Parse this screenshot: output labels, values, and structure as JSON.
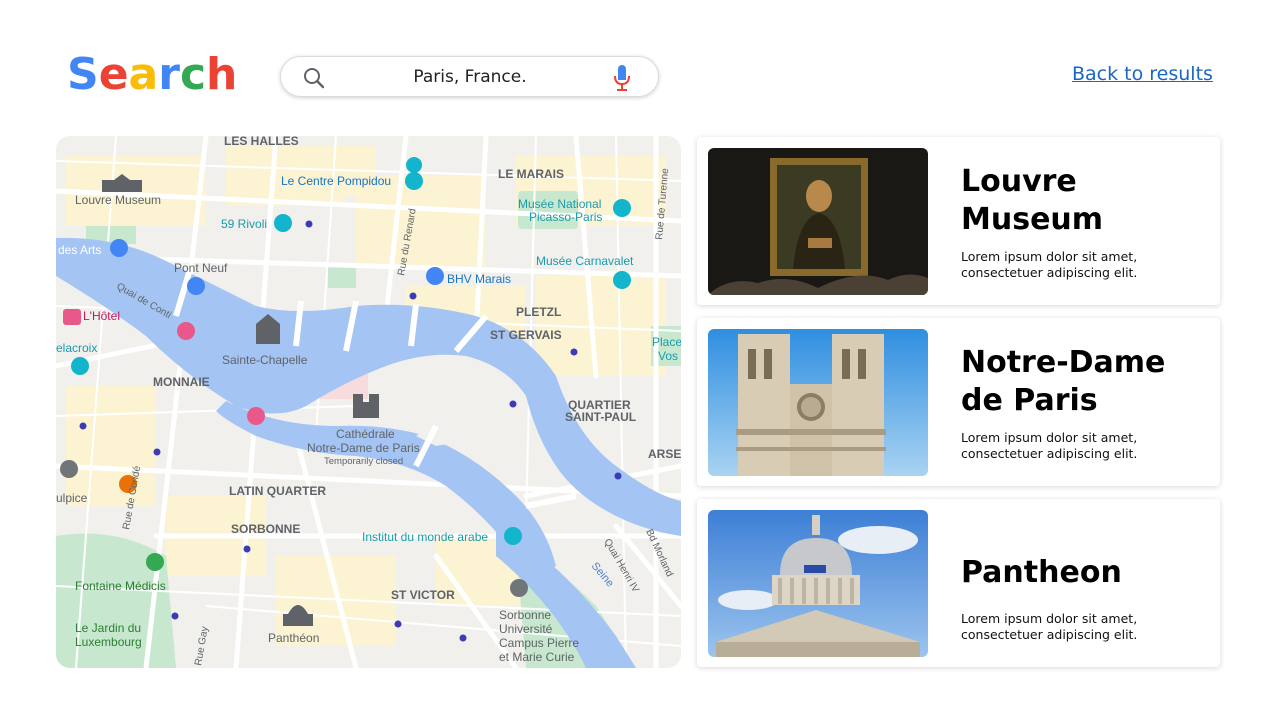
{
  "header": {
    "logo_letters": [
      {
        "char": "S",
        "color": "#4285F4"
      },
      {
        "char": "e",
        "color": "#EA4335"
      },
      {
        "char": "a",
        "color": "#FBBC05"
      },
      {
        "char": "r",
        "color": "#4285F4"
      },
      {
        "char": "c",
        "color": "#34A853"
      },
      {
        "char": "h",
        "color": "#EA4335"
      }
    ],
    "search": {
      "value": "Paris, France.",
      "search_icon": "magnifier-icon",
      "mic_icon": "microphone-icon"
    },
    "back_link": "Back to results"
  },
  "map": {
    "labels": {
      "les_halles": "LES HALLES",
      "louvre": "Louvre Museum",
      "pompidou": "Le Centre Pompidou",
      "le_marais": "LE MARAIS",
      "picasso_1": "Musée National",
      "picasso_2": "Picasso-Paris",
      "rivoli": "59 Rivoli",
      "des_arts": "des Arts",
      "rue_renard": "Rue du Renard",
      "bhv": "BHV Marais",
      "carnavalet": "Musée Carnavalet",
      "rue_turenne": "Rue de Turenne",
      "pont_neuf": "Pont Neuf",
      "quai_conti": "Quai de Conti",
      "lhotel": "L'Hôtel",
      "pletzl": "PLETZL",
      "st_gervais": "ST GERVAIS",
      "sainte_chapelle": "Sainte-Chapelle",
      "place_1": "Place",
      "place_2": "Vos",
      "delacroix": "elacroix",
      "monnaie": "MONNAIE",
      "quartier_1": "QUARTIER",
      "quartier_2": "SAINT-PAUL",
      "cathedrale_1": "Cathédrale",
      "cathedrale_2": "Notre-Dame de Paris",
      "temporarily": "Temporarily closed",
      "arse": "ARSE",
      "ulpice": "ulpice",
      "rue_conde": "Rue de Condé",
      "latin_quarter": "LATIN QUARTER",
      "sorbonne": "SORBONNE",
      "institut": "Institut du monde arabe",
      "quai_henri": "Quai Henri IV",
      "bd_morland": "Bd Morland",
      "seine": "Seine",
      "medicis": "Fontaine Médicis",
      "st_victor": "ST VICTOR",
      "sorbonne_univ_1": "Sorbonne",
      "sorbonne_univ_2": "Université",
      "sorbonne_univ_3": "Campus Pierre",
      "sorbonne_univ_4": "et Marie Curie",
      "jardin_1": "Le Jardin du",
      "jardin_2": "Luxembourg",
      "pantheon": "Panthéon",
      "rue_gay": "Rue Gay"
    }
  },
  "results": [
    {
      "title_1": "Louvre",
      "title_2": "Museum",
      "desc_1": "Lorem ipsum dolor sit amet,",
      "desc_2": "consectetuer adipiscing elit."
    },
    {
      "title_1": "Notre-Dame",
      "title_2": "de Paris",
      "desc_1": "Lorem ipsum dolor sit amet,",
      "desc_2": "consectetuer adipiscing elit."
    },
    {
      "title_1": "Pantheon",
      "desc_1": "Lorem ipsum dolor sit amet,",
      "desc_2": "consectetuer adipiscing elit."
    }
  ],
  "colors": {
    "link": "#1a66c4",
    "river": "#a4c4f4",
    "park": "#c7e8cf",
    "map_bg": "#f1f0ec",
    "block_yellow": "#fbf3d2"
  }
}
